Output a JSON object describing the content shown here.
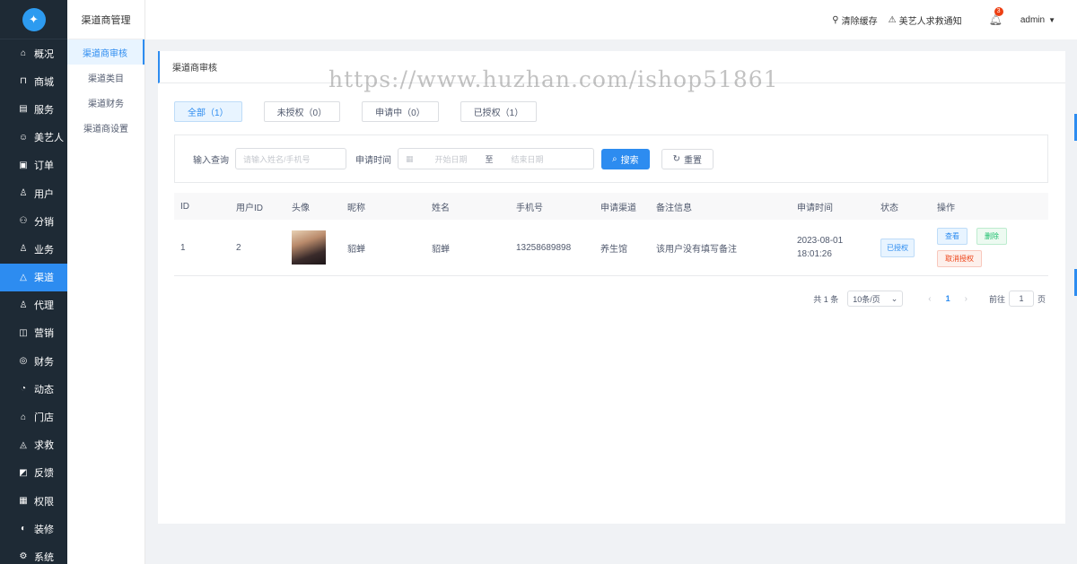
{
  "sidebar": {
    "logo_text": "",
    "items": [
      {
        "label": "概况",
        "icon": "home-icon"
      },
      {
        "label": "商城",
        "icon": "shop-icon"
      },
      {
        "label": "服务",
        "icon": "service-icon"
      },
      {
        "label": "美艺人",
        "icon": "artist-icon"
      },
      {
        "label": "订单",
        "icon": "order-icon"
      },
      {
        "label": "用户",
        "icon": "users-icon"
      },
      {
        "label": "分销",
        "icon": "distribution-icon"
      },
      {
        "label": "业务",
        "icon": "business-icon"
      },
      {
        "label": "渠道",
        "icon": "channel-icon",
        "active": true
      },
      {
        "label": "代理",
        "icon": "agent-icon"
      },
      {
        "label": "营销",
        "icon": "marketing-icon"
      },
      {
        "label": "财务",
        "icon": "finance-icon"
      },
      {
        "label": "动态",
        "icon": "dynamic-icon"
      },
      {
        "label": "门店",
        "icon": "store-icon"
      },
      {
        "label": "求救",
        "icon": "help-icon"
      },
      {
        "label": "反馈",
        "icon": "feedback-icon"
      },
      {
        "label": "权限",
        "icon": "permission-icon"
      },
      {
        "label": "装修",
        "icon": "decoration-icon"
      },
      {
        "label": "系统",
        "icon": "settings-icon"
      }
    ]
  },
  "submenu": {
    "title": "渠道商管理",
    "items": [
      "渠道商审核",
      "渠道类目",
      "渠道财务",
      "渠道商设置"
    ]
  },
  "header": {
    "clear_cache": "清除缓存",
    "sos_notice": "美艺人求救通知",
    "bell_badge": "3",
    "user": "admin"
  },
  "card": {
    "title": "渠道商审核",
    "watermark": "https://www.huzhan.com/ishop51861"
  },
  "tabs": [
    "全部（1）",
    "未授权（0）",
    "申请中（0）",
    "已授权（1）"
  ],
  "search": {
    "label_query": "输入查询",
    "query_placeholder": "请输入姓名/手机号",
    "label_time": "申请时间",
    "start_placeholder": "开始日期",
    "range_sep": "至",
    "end_placeholder": "结束日期",
    "search_btn": "搜索",
    "reset_btn": "重置"
  },
  "table": {
    "headers": [
      "ID",
      "用户ID",
      "头像",
      "昵称",
      "姓名",
      "手机号",
      "申请渠道",
      "备注信息",
      "申请时间",
      "状态",
      "操作"
    ],
    "rows": [
      {
        "id": "1",
        "user_id": "2",
        "nickname": "貂蝉",
        "name": "貂蝉",
        "phone": "13258689898",
        "channel": "养生馆",
        "remark": "该用户没有填写备注",
        "time_date": "2023-08-01",
        "time_clock": "18:01:26",
        "status": "已授权",
        "op_view": "查看",
        "op_delete": "删除",
        "op_cancel": "取消授权"
      }
    ]
  },
  "pager": {
    "total": "共 1 条",
    "page_size": "10条/页",
    "current": "1",
    "goto": "前往",
    "goto_value": "1",
    "page_unit": "页"
  }
}
